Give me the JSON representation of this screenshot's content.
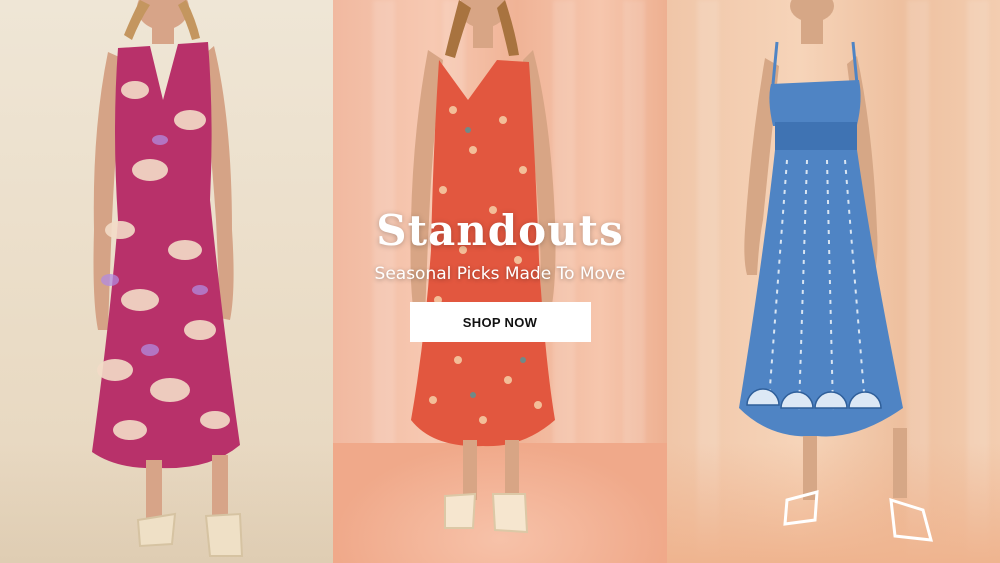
{
  "banner": {
    "headline": "Standouts",
    "subheadline": "Seasonal Picks Made To Move",
    "cta_label": "SHOP NOW"
  },
  "images": [
    {
      "description": "pink floral satin maxi dress",
      "accent": "#b8316a"
    },
    {
      "description": "coral ditsy floral slip dress",
      "accent": "#e2573f"
    },
    {
      "description": "blue shell embroidered midi dress",
      "accent": "#4f84c4"
    }
  ]
}
